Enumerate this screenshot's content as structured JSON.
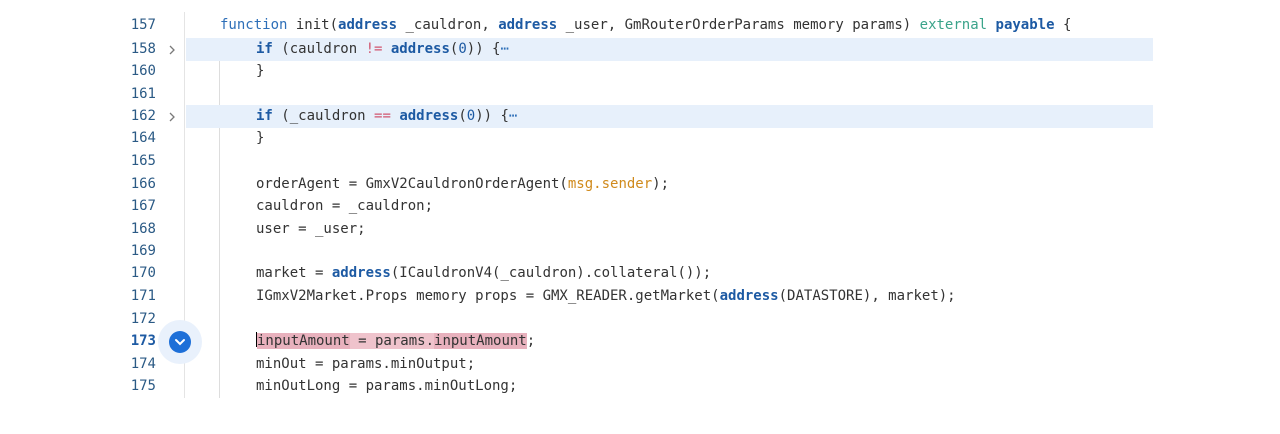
{
  "editor": {
    "lines": [
      {
        "num": "157",
        "text": "function init(address _cauldron, address _user, GmRouterOrderParams memory params) external payable {"
      },
      {
        "num": "158",
        "text": "if (cauldron != address(0)) {⋯",
        "folded": true,
        "highlighted": true
      },
      {
        "num": "160",
        "text": "}"
      },
      {
        "num": "161",
        "text": ""
      },
      {
        "num": "162",
        "text": "if (_cauldron == address(0)) {⋯",
        "folded": true,
        "highlighted": true
      },
      {
        "num": "164",
        "text": "}"
      },
      {
        "num": "165",
        "text": ""
      },
      {
        "num": "166",
        "text": "orderAgent = GmxV2CauldronOrderAgent(msg.sender);"
      },
      {
        "num": "167",
        "text": "cauldron = _cauldron;"
      },
      {
        "num": "168",
        "text": "user = _user;"
      },
      {
        "num": "169",
        "text": ""
      },
      {
        "num": "170",
        "text": "market = address(ICauldronV4(_cauldron).collateral());"
      },
      {
        "num": "171",
        "text": "IGmxV2Market.Props memory props = GMX_READER.getMarket(address(DATASTORE), market);"
      },
      {
        "num": "172",
        "text": ""
      },
      {
        "num": "173",
        "text": "inputAmount = params.inputAmount;",
        "current": true
      },
      {
        "num": "174",
        "text": "minOut = params.minOutput;"
      },
      {
        "num": "175",
        "text": "minOutLong = params.minOutLong;"
      }
    ],
    "tokens": {
      "l157": [
        "function",
        " init(",
        "address",
        " _cauldron, ",
        "address",
        " _user, GmRouterOrderParams memory params) ",
        "external",
        " ",
        "payable",
        " {"
      ],
      "l158": [
        "if",
        " (cauldron ",
        "!=",
        " ",
        "address",
        "(",
        "0",
        ")) {",
        "⋯"
      ],
      "l162": [
        "if",
        " (_cauldron ",
        "==",
        " ",
        "address",
        "(",
        "0",
        ")) {",
        "⋯"
      ],
      "l166": [
        "orderAgent = GmxV2CauldronOrderAgent(",
        "msg.sender",
        ");"
      ],
      "l170": [
        "market = ",
        "address",
        "(ICauldronV4(_cauldron).collateral());"
      ],
      "l171": [
        "IGmxV2Market.Props memory props = GMX_READER.getMarket(",
        "address",
        "(DATASTORE), market);"
      ],
      "l173": [
        "inputAmount",
        " = params.",
        "inputAmount",
        ";"
      ]
    },
    "breakpoint_icon": "chevron-down-icon",
    "fold_icon": "chevron-right-icon",
    "colors": {
      "line_number": "#2b5a85",
      "keyword": "#1d5aa3",
      "external": "#3aa38a",
      "operator": "#d1556f",
      "global": "#d08a1c",
      "highlight_bg": "#e7f0fb",
      "selection_bg": "#e8b1bd",
      "marker": "#1d6fd8"
    }
  }
}
